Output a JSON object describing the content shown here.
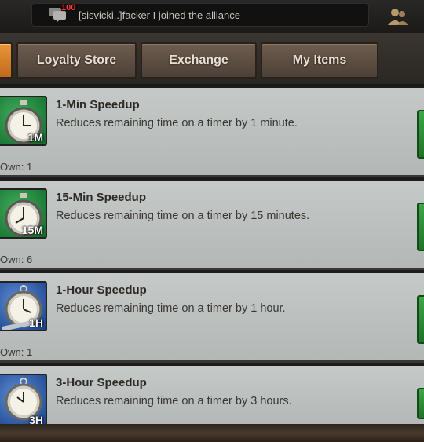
{
  "chat": {
    "badge": "100",
    "message": "[sisvicki..]facker I joined the alliance",
    "chat_icon": "chat-bubble-icon",
    "alliance_icon": "alliance-members-icon"
  },
  "tabs": [
    {
      "label": "",
      "active": true
    },
    {
      "label": "Loyalty Store",
      "active": false
    },
    {
      "label": "Exchange",
      "active": false
    },
    {
      "label": "My Items",
      "active": false
    }
  ],
  "items": [
    {
      "title": "1-Min Speedup",
      "description": "Reduces remaining time on a timer by 1 minute.",
      "own": "Own: 1",
      "icon_label": "1M",
      "icon_color": "#2e9a4c",
      "icon": "stopwatch-icon"
    },
    {
      "title": "15-Min Speedup",
      "description": "Reduces remaining time on a timer by 15 minutes.",
      "own": "Own: 6",
      "icon_label": "15M",
      "icon_color": "#2e9a4c",
      "icon": "stopwatch-icon"
    },
    {
      "title": "1-Hour Speedup",
      "description": "Reduces remaining time on a timer by 1 hour.",
      "own": "Own: 1",
      "icon_label": "1H",
      "icon_color": "#3b6fc2",
      "icon": "pocket-watch-icon"
    },
    {
      "title": "3-Hour Speedup",
      "description": "Reduces remaining time on a timer by 3 hours.",
      "own": "",
      "icon_label": "3H",
      "icon_color": "#3b6fc2",
      "icon": "pocket-watch-icon"
    }
  ]
}
